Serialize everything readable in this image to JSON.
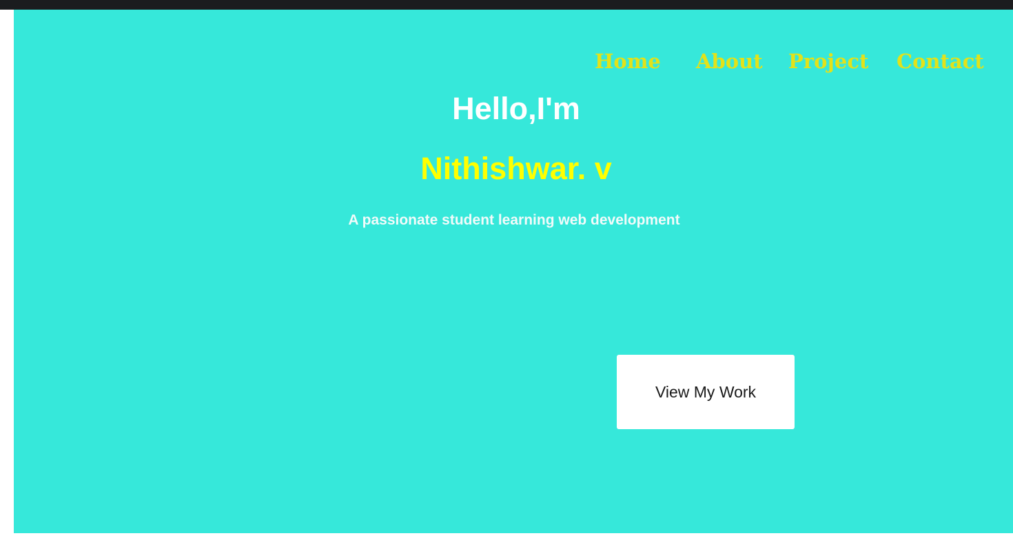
{
  "nav": {
    "items": [
      {
        "label": "Home"
      },
      {
        "label": "About"
      },
      {
        "label": "Project"
      },
      {
        "label": "Contact"
      }
    ]
  },
  "hero": {
    "greeting": "Hello,I'm",
    "name": "Nithishwar. v",
    "tagline": "A passionate student learning web development",
    "cta_label": "View My Work"
  },
  "colors": {
    "background": "#36e8da",
    "nav_link": "#e2e21a",
    "name": "#ffff00",
    "text": "#ffffff",
    "topbar": "#1b1c1f"
  }
}
